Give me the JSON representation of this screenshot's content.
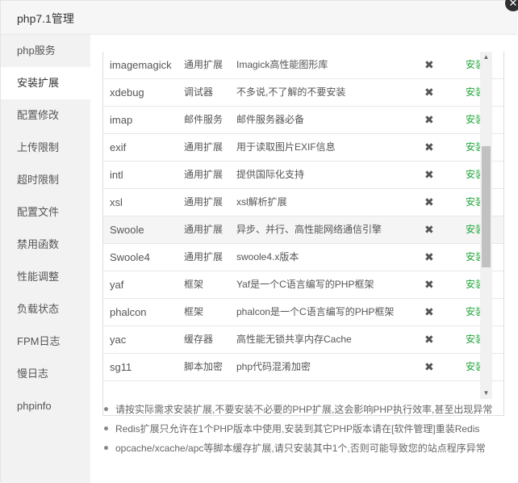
{
  "dialog": {
    "title": "php7.1管理",
    "close_label": "✕"
  },
  "sidebar": {
    "items": [
      {
        "label": "php服务"
      },
      {
        "label": "安装扩展"
      },
      {
        "label": "配置修改"
      },
      {
        "label": "上传限制"
      },
      {
        "label": "超时限制"
      },
      {
        "label": "配置文件"
      },
      {
        "label": "禁用函数"
      },
      {
        "label": "性能调整"
      },
      {
        "label": "负载状态"
      },
      {
        "label": "FPM日志"
      },
      {
        "label": "慢日志"
      },
      {
        "label": "phpinfo"
      }
    ],
    "active_index": 1
  },
  "extensions": {
    "rows": [
      {
        "name": "imagemagick",
        "type": "通用扩展",
        "desc": "Imagick高性能图形库",
        "status": "✖",
        "action": "安装"
      },
      {
        "name": "xdebug",
        "type": "调试器",
        "desc": "不多说,不了解的不要安装",
        "status": "✖",
        "action": "安装"
      },
      {
        "name": "imap",
        "type": "邮件服务",
        "desc": "邮件服务器必备",
        "status": "✖",
        "action": "安装"
      },
      {
        "name": "exif",
        "type": "通用扩展",
        "desc": "用于读取图片EXIF信息",
        "status": "✖",
        "action": "安装"
      },
      {
        "name": "intl",
        "type": "通用扩展",
        "desc": "提供国际化支持",
        "status": "✖",
        "action": "安装"
      },
      {
        "name": "xsl",
        "type": "通用扩展",
        "desc": "xsl解析扩展",
        "status": "✖",
        "action": "安装"
      },
      {
        "name": "Swoole",
        "type": "通用扩展",
        "desc": "异步、并行、高性能网络通信引擎",
        "status": "✖",
        "action": "安装"
      },
      {
        "name": "Swoole4",
        "type": "通用扩展",
        "desc": "swoole4.x版本",
        "status": "✖",
        "action": "安装"
      },
      {
        "name": "yaf",
        "type": "框架",
        "desc": "Yaf是一个C语言编写的PHP框架",
        "status": "✖",
        "action": "安装"
      },
      {
        "name": "phalcon",
        "type": "框架",
        "desc": "phalcon是一个C语言编写的PHP框架",
        "status": "✖",
        "action": "安装"
      },
      {
        "name": "yac",
        "type": "缓存器",
        "desc": "高性能无锁共享内存Cache",
        "status": "✖",
        "action": "安装"
      },
      {
        "name": "sg11",
        "type": "脚本加密",
        "desc": "php代码混淆加密",
        "status": "✖",
        "action": "安装"
      },
      {
        "name": "",
        "type": "",
        "desc": "",
        "status": "",
        "action": ""
      }
    ],
    "hover_index": 6
  },
  "scroll": {
    "up": "▲",
    "down": "▼"
  },
  "notes": [
    "请按实际需求安装扩展,不要安装不必要的PHP扩展,这会影响PHP执行效率,甚至出现异常",
    "Redis扩展只允许在1个PHP版本中使用,安装到其它PHP版本请在[软件管理]重装Redis",
    "opcache/xcache/apc等脚本缓存扩展,请只安装其中1个,否则可能导致您的站点程序异常"
  ],
  "colors": {
    "accent_green": "#20a53a",
    "sidebar_bg": "#f2f2f2",
    "titlebar_bg": "#f6f6f6"
  }
}
